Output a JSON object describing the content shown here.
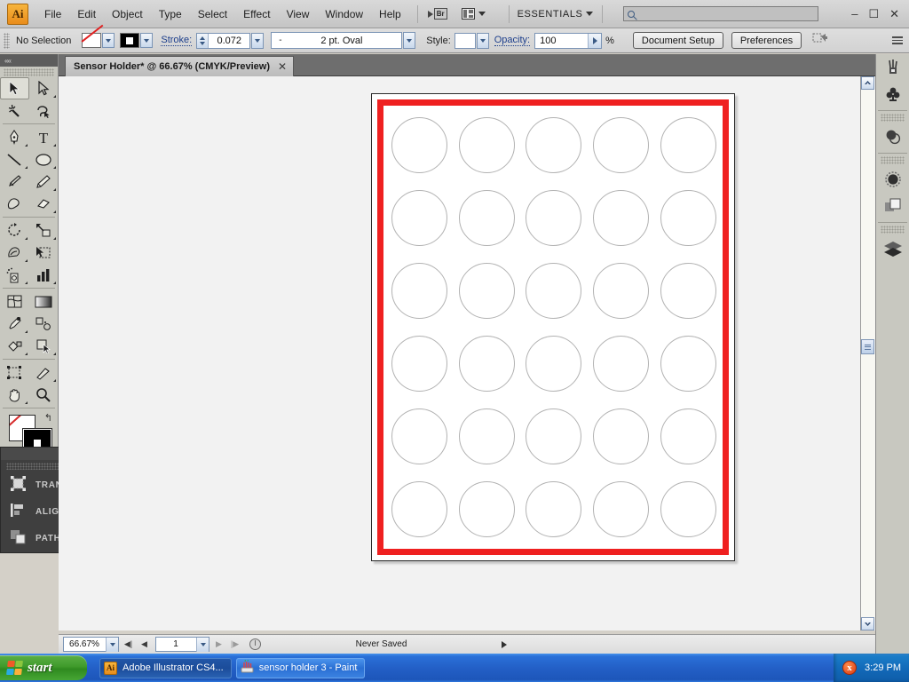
{
  "app": {
    "logo": "Ai",
    "menus": [
      "File",
      "Edit",
      "Object",
      "Type",
      "Select",
      "Effect",
      "View",
      "Window",
      "Help"
    ],
    "bridge_label": "Br",
    "workspace": "ESSENTIALS",
    "search_placeholder": "",
    "window_buttons": {
      "minimize": "–",
      "maximize": "☐",
      "close": "✕"
    }
  },
  "control_bar": {
    "selection_label": "No Selection",
    "fill_swatch": "none-swatch",
    "stroke_swatch": "black-square-swatch",
    "stroke_label": "Stroke:",
    "stroke_weight": "0.072",
    "brush_definition": "2 pt. Oval",
    "brush_prefix": "-",
    "style_label": "Style:",
    "opacity_label": "Opacity:",
    "opacity_value": "100",
    "opacity_unit": "%",
    "document_setup": "Document Setup",
    "preferences": "Preferences"
  },
  "document_tab": {
    "title": "Sensor Holder* @ 66.67% (CMYK/Preview)",
    "close": "✕"
  },
  "toolbar": {
    "collapse": "««",
    "tools": [
      {
        "name": "selection-tool",
        "selected": true,
        "flyout": false
      },
      {
        "name": "direct-selection-tool",
        "selected": false,
        "flyout": true
      },
      {
        "name": "magic-wand-tool",
        "selected": false,
        "flyout": false
      },
      {
        "name": "lasso-tool",
        "selected": false,
        "flyout": false
      },
      {
        "name": "pen-tool",
        "selected": false,
        "flyout": true
      },
      {
        "name": "type-tool",
        "selected": false,
        "flyout": true
      },
      {
        "name": "line-segment-tool",
        "selected": false,
        "flyout": true
      },
      {
        "name": "ellipse-tool",
        "selected": false,
        "flyout": true
      },
      {
        "name": "paintbrush-tool",
        "selected": false,
        "flyout": false
      },
      {
        "name": "pencil-tool",
        "selected": false,
        "flyout": true
      },
      {
        "name": "blob-brush-tool",
        "selected": false,
        "flyout": false
      },
      {
        "name": "eraser-tool",
        "selected": false,
        "flyout": true
      },
      {
        "name": "rotate-tool",
        "selected": false,
        "flyout": true
      },
      {
        "name": "scale-tool",
        "selected": false,
        "flyout": true
      },
      {
        "name": "warp-tool",
        "selected": false,
        "flyout": true
      },
      {
        "name": "free-transform-tool",
        "selected": false,
        "flyout": false
      },
      {
        "name": "symbol-sprayer-tool",
        "selected": false,
        "flyout": true
      },
      {
        "name": "column-graph-tool",
        "selected": false,
        "flyout": true
      },
      {
        "name": "mesh-tool",
        "selected": false,
        "flyout": false
      },
      {
        "name": "gradient-tool",
        "selected": false,
        "flyout": false
      },
      {
        "name": "eyedropper-tool",
        "selected": false,
        "flyout": true
      },
      {
        "name": "blend-tool",
        "selected": false,
        "flyout": false
      },
      {
        "name": "live-paint-bucket-tool",
        "selected": false,
        "flyout": true
      },
      {
        "name": "live-paint-selection-tool",
        "selected": false,
        "flyout": true
      },
      {
        "name": "artboard-tool",
        "selected": false,
        "flyout": false
      },
      {
        "name": "slice-tool",
        "selected": false,
        "flyout": true
      },
      {
        "name": "hand-tool",
        "selected": false,
        "flyout": true
      },
      {
        "name": "zoom-tool",
        "selected": false,
        "flyout": false
      }
    ],
    "fill_state": "none",
    "stroke_state": "black",
    "swap_icon": "↰",
    "color_modes": [
      "color-mode",
      "gradient-mode",
      "none-mode"
    ],
    "screen_mode": "change-screen-mode"
  },
  "float_panel": {
    "collapse_icon": "▸▸",
    "close_icon": "✕",
    "items": [
      {
        "label": "TRANSFORM",
        "icon": "transform-icon"
      },
      {
        "label": "ALIGN",
        "icon": "align-icon"
      },
      {
        "label": "PATHFINDER",
        "icon": "pathfinder-icon"
      }
    ]
  },
  "right_dock": {
    "items": [
      {
        "name": "brushes-panel-icon"
      },
      {
        "name": "symbols-panel-icon"
      },
      {
        "name": "transparency-panel-icon"
      },
      {
        "name": "appearance-panel-icon"
      },
      {
        "name": "graphic-styles-panel-icon"
      },
      {
        "name": "layers-panel-icon"
      }
    ]
  },
  "artwork": {
    "frame_color": "#ef2020",
    "artboard_color": "#ffffff",
    "circle_stroke_color": "#b2b2b2",
    "circle_rows": 6,
    "circle_columns": 5,
    "circle_count": 30
  },
  "status_bar": {
    "zoom": "66.67%",
    "page": "1",
    "first_icon": "◀|",
    "prev_icon": "◀",
    "next_icon": "▶",
    "last_icon": "|▶",
    "info_text": "Never Saved"
  },
  "taskbar": {
    "start_label": "start",
    "buttons": [
      {
        "label": "Adobe Illustrator CS4...",
        "icon": "ai-icon",
        "active": true
      },
      {
        "label": "sensor holder 3 - Paint",
        "icon": "paint-icon",
        "active": false
      }
    ],
    "tray_icon": "antivirus-alert-icon",
    "clock": "3:29 PM"
  }
}
